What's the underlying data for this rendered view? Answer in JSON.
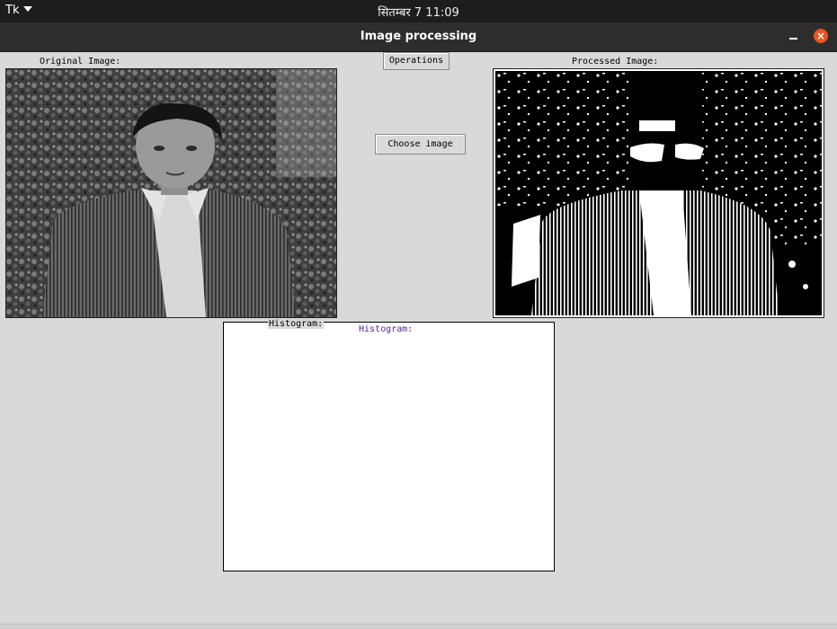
{
  "topbar": {
    "app_menu": "Tk",
    "clock": "सितम्बर 7  11:09"
  },
  "window": {
    "title": "Image processing",
    "minimize_symbol": "–",
    "close_symbol": "×"
  },
  "labels": {
    "original": "Original Image:",
    "processed": "Processed Image:",
    "histogram": "Histogram:",
    "histogram_plot_title": "Histogram:"
  },
  "buttons": {
    "operations": "Operations",
    "choose_image": "Choose image"
  },
  "colors": {
    "close_button": "#e95420",
    "histogram_title": "#5b1f8f",
    "window_bg": "#d9d9d9"
  }
}
